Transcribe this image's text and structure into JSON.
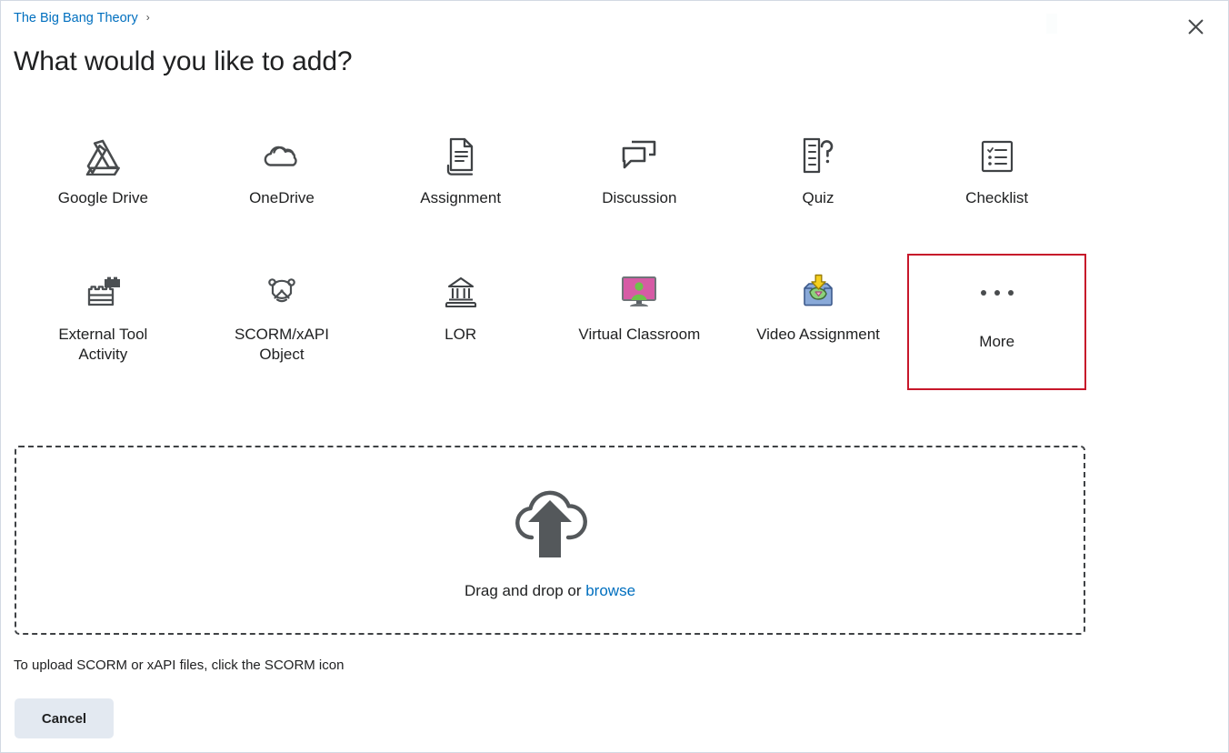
{
  "dialog": {
    "breadcrumb": {
      "label": "The Big Bang Theory",
      "separator": "›"
    },
    "title": "What would you like to add?",
    "close_label": "×"
  },
  "content_types": [
    {
      "label": "Google Drive",
      "icon": "google-drive-icon",
      "focused": false
    },
    {
      "label": "OneDrive",
      "icon": "onedrive-icon",
      "focused": false
    },
    {
      "label": "Assignment",
      "icon": "assignment-document-icon",
      "focused": false
    },
    {
      "label": "Discussion",
      "icon": "discussion-bubbles-icon",
      "focused": false
    },
    {
      "label": "Quiz",
      "icon": "quiz-question-icon",
      "focused": false
    },
    {
      "label": "Checklist",
      "icon": "checklist-icon",
      "focused": false
    },
    {
      "label": "External Tool Activity",
      "icon": "lego-brick-icon",
      "focused": false
    },
    {
      "label": "SCORM/xAPI Object",
      "icon": "scorm-xapi-icon",
      "focused": false
    },
    {
      "label": "LOR",
      "icon": "library-building-icon",
      "focused": false
    },
    {
      "label": "Virtual Classroom",
      "icon": "virtual-classroom-monitor-icon",
      "focused": false
    },
    {
      "label": "Video Assignment",
      "icon": "video-assignment-inbox-icon",
      "focused": false
    },
    {
      "label": "More",
      "icon": "ellipsis-icon",
      "focused": true
    }
  ],
  "dropzone": {
    "icon": "cloud-upload-icon",
    "text_prefix": "Drag and drop or ",
    "browse_label": "browse"
  },
  "footer": {
    "note": "To upload SCORM or xAPI files, click the SCORM icon",
    "cancel_label": "Cancel"
  },
  "colors": {
    "link": "#006fbf",
    "focus_outline": "#c7172a",
    "icon_dark": "#494c4e",
    "virtual_classroom_screen": "#d65ba5",
    "virtual_classroom_person": "#6cc24a",
    "video_tray": "#89a9d8",
    "video_arrow": "#f5cf1e",
    "cancel_bg": "#e3e9f1"
  }
}
